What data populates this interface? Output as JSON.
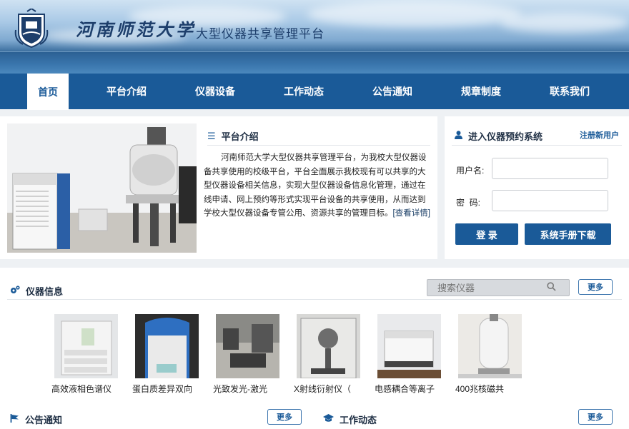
{
  "header": {
    "university_name": "河南师范大学",
    "platform_title": "大型仪器共享管理平台"
  },
  "nav": {
    "items": [
      {
        "label": "首页",
        "active": true
      },
      {
        "label": "平台介绍"
      },
      {
        "label": "仪器设备"
      },
      {
        "label": "工作动态"
      },
      {
        "label": "公告通知"
      },
      {
        "label": "规章制度"
      },
      {
        "label": "联系我们"
      }
    ]
  },
  "intro": {
    "title": "平台介绍",
    "body": "河南师范大学大型仪器共享管理平台，为我校大型仪器设备共享使用的校级平台，平台全面展示我校现有可以共享的大型仪器设备相关信息，实现大型仪器设备信息化管理，通过在线申请、网上预约等形式实现平台设备的共享使用，从而达到学校大型仪器设备专管公用、资源共享的管理目标。",
    "more_link": "[查看详情]"
  },
  "login": {
    "title": "进入仪器预约系统",
    "register_link": "注册新用户",
    "username_label": "用户名:",
    "password_label": "密  码:",
    "login_button": "登 录",
    "manual_button": "系统手册下载"
  },
  "instruments": {
    "title": "仪器信息",
    "search_placeholder": "搜索仪器",
    "more_button": "更多",
    "items": [
      {
        "name": "高效液相色谱仪"
      },
      {
        "name": "蛋白质差异双向"
      },
      {
        "name": "光致发光-激光"
      },
      {
        "name": "X射线衍射仪（"
      },
      {
        "name": "电感耦合等离子"
      },
      {
        "name": "400兆核磁共"
      }
    ]
  },
  "notices": {
    "title": "公告通知",
    "more_button": "更多"
  },
  "news": {
    "title": "工作动态",
    "more_button": "更多"
  },
  "colors": {
    "primary": "#1a5a98",
    "background": "#eef1f4"
  },
  "icons": {
    "list": "list-icon",
    "user": "user-icon",
    "gears": "gears-icon",
    "search": "search-icon",
    "flag": "flag-icon",
    "graduation_cap": "graduation-cap-icon"
  }
}
